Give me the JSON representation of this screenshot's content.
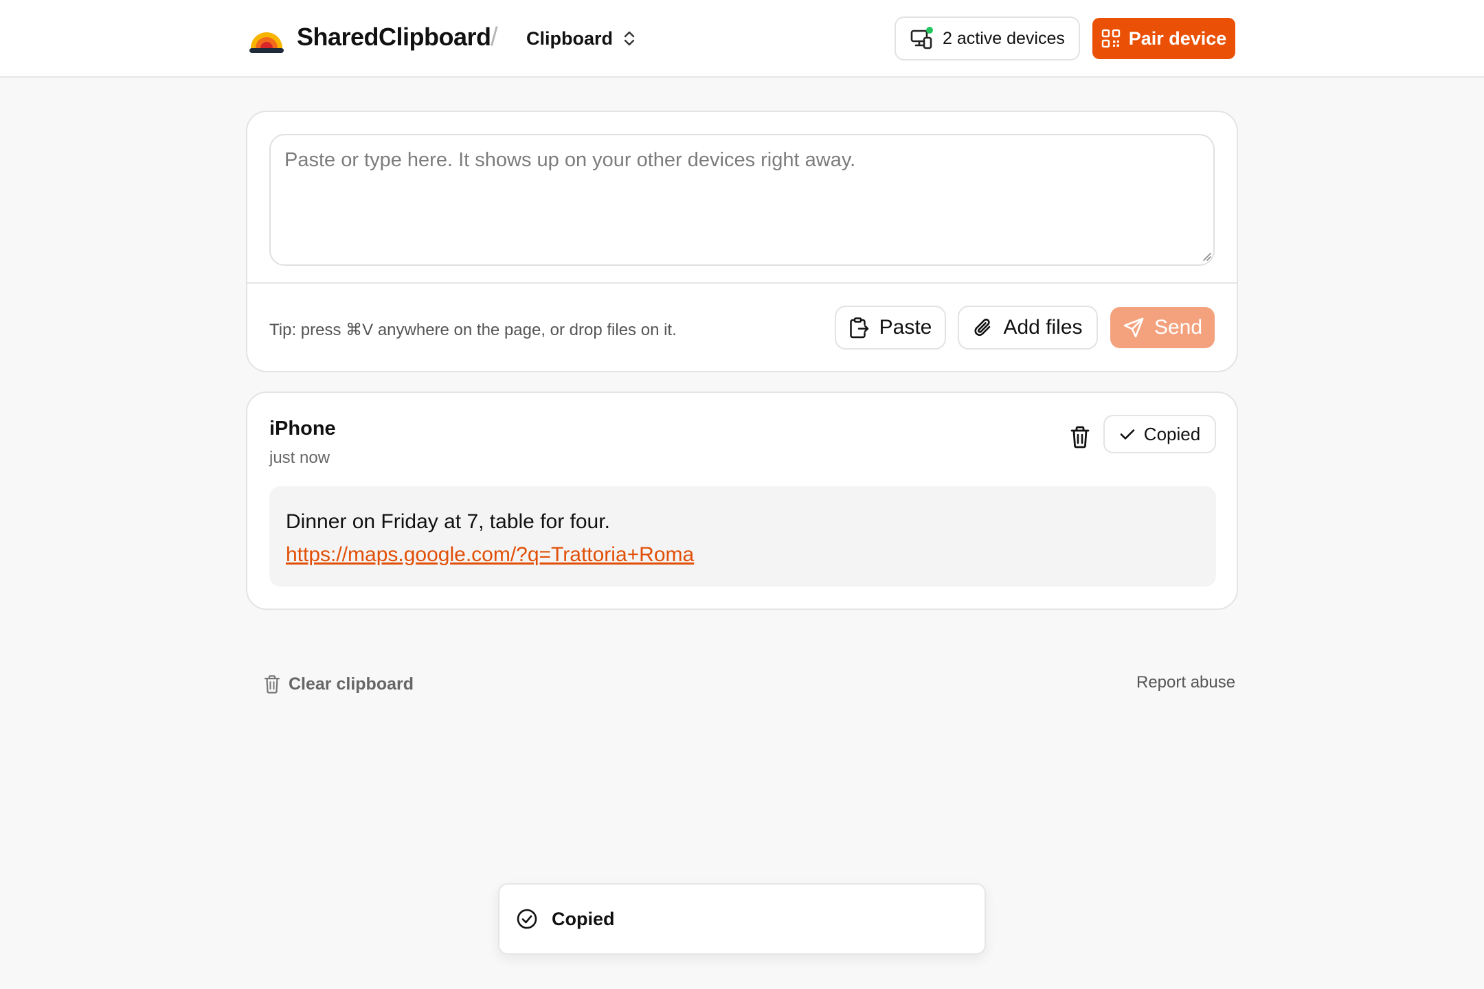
{
  "header": {
    "brand": "SharedClipboard",
    "separator": "/",
    "context_label": "Clipboard",
    "devices_label": "2 active devices",
    "pair_label": "Pair device"
  },
  "composer": {
    "placeholder": "Paste or type here. It shows up on your other devices right away.",
    "value": "",
    "tip": "Tip: press ⌘V anywhere on the page, or drop files on it.",
    "paste_label": "Paste",
    "add_files_label": "Add files",
    "send_label": "Send"
  },
  "clips": [
    {
      "device": "iPhone",
      "time": "just now",
      "copied_label": "Copied",
      "text": "Dinner on Friday at 7, table for four.",
      "link": "https://maps.google.com/?q=Trattoria+Roma"
    }
  ],
  "footer": {
    "clear_label": "Clear clipboard",
    "report_label": "Report abuse"
  },
  "toast": {
    "message": "Copied"
  },
  "colors": {
    "accent": "#ea5106",
    "accent_disabled": "#f4a27e",
    "link": "#e14f06",
    "online_dot": "#22c55e",
    "background": "#f8f8f8"
  },
  "icons": {
    "logo": "sunset-logo-icon",
    "context_toggle": "chevron-up-down-icon",
    "devices": "devices-icon",
    "pair": "qr-code-icon",
    "paste": "clipboard-icon",
    "add_files": "paperclip-icon",
    "send": "send-icon",
    "delete": "trash-icon",
    "copied": "check-icon",
    "toast": "check-circle-icon"
  }
}
